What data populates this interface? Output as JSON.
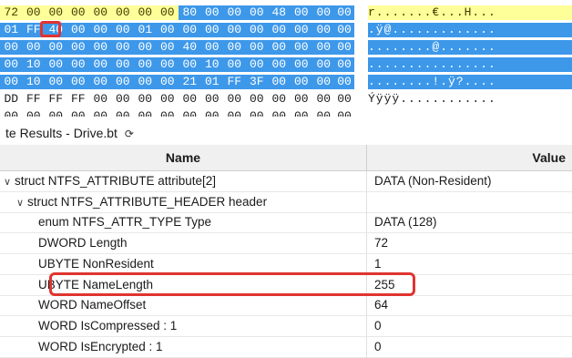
{
  "hex": {
    "lines": [
      {
        "bytes": [
          "72",
          "00",
          "00",
          "00",
          "00",
          "00",
          "00",
          "00",
          "80",
          "00",
          "00",
          "00",
          "48",
          "00",
          "00",
          "00"
        ],
        "styles": [
          "y",
          "y",
          "y",
          "y",
          "y",
          "y",
          "y",
          "y",
          "b",
          "b",
          "b",
          "b",
          "b",
          "b",
          "b",
          "b"
        ],
        "ascii": "r.......€...H...",
        "ascii_style": "y"
      },
      {
        "bytes": [
          "01",
          "FF",
          "40",
          "00",
          "00",
          "00",
          "01",
          "00",
          "00",
          "00",
          "00",
          "00",
          "00",
          "00",
          "00",
          "00"
        ],
        "styles": [
          "b",
          "b",
          "b",
          "b",
          "b",
          "b",
          "b",
          "b",
          "b",
          "b",
          "b",
          "b",
          "b",
          "b",
          "b",
          "b"
        ],
        "ascii": ".ÿ@.............",
        "ascii_style": "b"
      },
      {
        "bytes": [
          "00",
          "00",
          "00",
          "00",
          "00",
          "00",
          "00",
          "00",
          "40",
          "00",
          "00",
          "00",
          "00",
          "00",
          "00",
          "00"
        ],
        "styles": [
          "b",
          "b",
          "b",
          "b",
          "b",
          "b",
          "b",
          "b",
          "b",
          "b",
          "b",
          "b",
          "b",
          "b",
          "b",
          "b"
        ],
        "ascii": "........@.......",
        "ascii_style": "b"
      },
      {
        "bytes": [
          "00",
          "10",
          "00",
          "00",
          "00",
          "00",
          "00",
          "00",
          "00",
          "10",
          "00",
          "00",
          "00",
          "00",
          "00",
          "00"
        ],
        "styles": [
          "b",
          "b",
          "b",
          "b",
          "b",
          "b",
          "b",
          "b",
          "b",
          "b",
          "b",
          "b",
          "b",
          "b",
          "b",
          "b"
        ],
        "ascii": "................",
        "ascii_style": "b"
      },
      {
        "bytes": [
          "00",
          "10",
          "00",
          "00",
          "00",
          "00",
          "00",
          "00",
          "21",
          "01",
          "FF",
          "3F",
          "00",
          "00",
          "00",
          "00"
        ],
        "styles": [
          "b",
          "b",
          "b",
          "b",
          "b",
          "b",
          "b",
          "b",
          "b",
          "b",
          "b",
          "b",
          "b",
          "b",
          "b",
          "b"
        ],
        "ascii": "........!.ÿ?....",
        "ascii_style": "b"
      },
      {
        "bytes": [
          "DD",
          "FF",
          "FF",
          "FF",
          "00",
          "00",
          "00",
          "00",
          "00",
          "00",
          "00",
          "00",
          "00",
          "00",
          "00",
          "00"
        ],
        "styles": [
          "p",
          "p",
          "p",
          "p",
          "p",
          "p",
          "p",
          "p",
          "p",
          "p",
          "p",
          "p",
          "p",
          "p",
          "p",
          "p"
        ],
        "ascii": "Ýÿÿÿ............",
        "ascii_style": "p"
      },
      {
        "bytes": [
          "00",
          "00",
          "00",
          "00",
          "00",
          "00",
          "00",
          "00",
          "00",
          "00",
          "00",
          "00",
          "00",
          "00",
          "00",
          "00"
        ],
        "styles": [
          "p",
          "p",
          "p",
          "p",
          "p",
          "p",
          "p",
          "p",
          "p",
          "p",
          "p",
          "p",
          "p",
          "p",
          "p",
          "p"
        ],
        "ascii": "",
        "ascii_style": "p"
      }
    ]
  },
  "results": {
    "title": "te Results - Drive.bt",
    "refresh_icon": "⟳",
    "columns": {
      "name": "Name",
      "value": "Value"
    },
    "rows": [
      {
        "indent": 1,
        "expander": "∨",
        "name": "struct NTFS_ATTRIBUTE attribute[2]",
        "value": "DATA (Non-Resident)"
      },
      {
        "indent": 2,
        "expander": "∨",
        "name": "struct NTFS_ATTRIBUTE_HEADER header",
        "value": ""
      },
      {
        "indent": 3,
        "expander": "",
        "name": "enum NTFS_ATTR_TYPE Type",
        "value": "DATA (128)"
      },
      {
        "indent": 3,
        "expander": "",
        "name": "DWORD Length",
        "value": "72"
      },
      {
        "indent": 3,
        "expander": "",
        "name": "UBYTE NonResident",
        "value": "1"
      },
      {
        "indent": 3,
        "expander": "",
        "name": "UBYTE NameLength",
        "value": "255",
        "highlighted": true
      },
      {
        "indent": 3,
        "expander": "",
        "name": "WORD NameOffset",
        "value": "64"
      },
      {
        "indent": 3,
        "expander": "",
        "name": "WORD IsCompressed : 1",
        "value": "0"
      },
      {
        "indent": 3,
        "expander": "",
        "name": "WORD IsEncrypted : 1",
        "value": "0"
      }
    ]
  },
  "colors": {
    "hex_yellow": "#ffff99",
    "hex_blue": "#3d98ea",
    "highlight_red": "#e0342f"
  }
}
